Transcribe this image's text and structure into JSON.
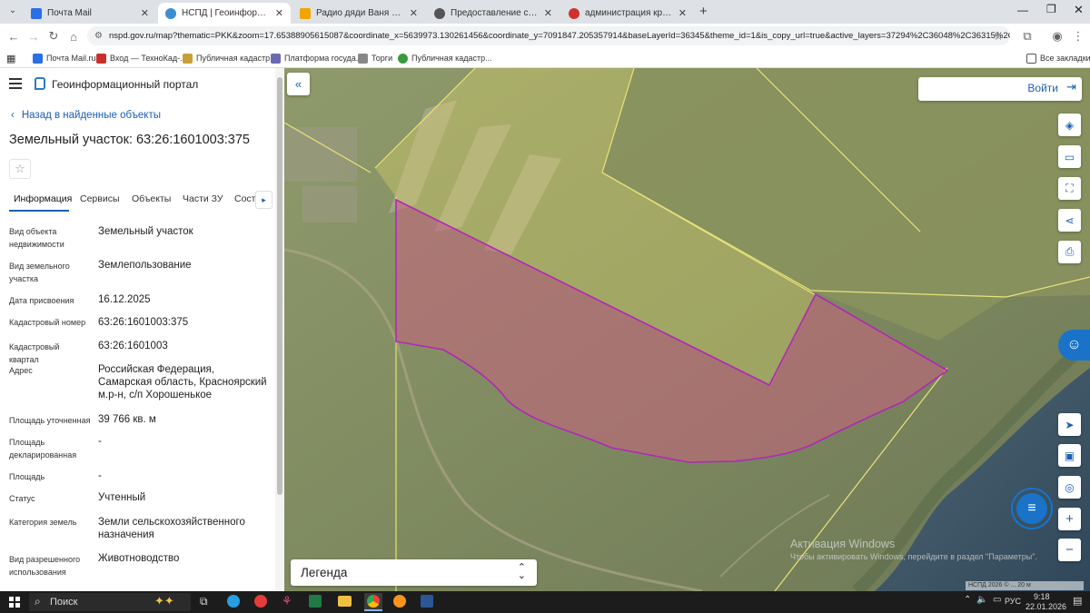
{
  "browser": {
    "tabs": [
      {
        "title": "Почта Mail",
        "color": "#2a6ee8"
      },
      {
        "title": "НСПД | Геоинформационны",
        "color": "#3a8fd0"
      },
      {
        "title": "Радио дяди Ваня на даче слуш",
        "color": "#f2a400"
      },
      {
        "title": "Предоставление сведений из",
        "color": "#555555"
      },
      {
        "title": "администрация красноярско",
        "color": "#d0312d"
      }
    ],
    "new_tab": "+",
    "url": "nspd.gov.ru/map?thematic=PKK&zoom=17.65388905615087&coordinate_x=5639973.130261456&coordinate_y=7091847.205357914&baseLayerId=36345&theme_id=1&is_copy_url=true&active_layers=37294%2C36048%2C36315%2C36311%2C36...",
    "bookmarks": [
      "Почта Mail.ru",
      "Вход — ТехноКад-...",
      "Публичная кадастр...",
      "Платформа госуда...",
      "Торги",
      "Публичная кадастр..."
    ],
    "all_bookmarks": "Все закладки"
  },
  "portal": {
    "title": "Геоинформационный портал",
    "back_link": "Назад в найденные объекты",
    "object_title": "Земельный участок: 63:26:1601003:375",
    "tabs": [
      "Информация",
      "Сервисы",
      "Объекты",
      "Части ЗУ",
      "Соста"
    ],
    "attributes": [
      {
        "label": "Вид объекта недвижимости",
        "value": "Земельный участок"
      },
      {
        "label": "Вид земельного участка",
        "value": "Землепользование"
      },
      {
        "label": "Дата присвоения",
        "value": "16.12.2025"
      },
      {
        "label": "Кадастровый номер",
        "value": "63:26:1601003:375"
      },
      {
        "label": "Кадастровый квартал",
        "value": "63:26:1601003"
      },
      {
        "label": "Адрес",
        "value": "Российская Федерация, Самарская область, Красноярский м.р-н, с/п Хорошенькое"
      },
      {
        "label": "Площадь уточненная",
        "value": "39 766 кв. м"
      },
      {
        "label": "Площадь декларированная",
        "value": "-"
      },
      {
        "label": "Площадь",
        "value": "-"
      },
      {
        "label": "Статус",
        "value": "Учтенный"
      },
      {
        "label": "Категория земель",
        "value": "Земли сельскохозяйственного назначения"
      },
      {
        "label": "Вид разрешенного использования",
        "value": "Животноводство"
      }
    ]
  },
  "map": {
    "login": "Войти",
    "legend": "Легенда",
    "scale_text": "НСПД 2026 © ... 20 м",
    "watermark_title": "Активация Windows",
    "watermark_sub": "Чтобы активировать Windows, перейдите в раздел \"Параметры\"."
  },
  "taskbar": {
    "search": "Поиск",
    "lang": "РУС",
    "time": "9:18",
    "date": "22.01.2026"
  },
  "colors": {
    "accent": "#1a5fb4",
    "parcel_fill": "#c8627f",
    "parcel_stroke": "#b028b8",
    "boundary_yellow": "#e9e27a"
  }
}
